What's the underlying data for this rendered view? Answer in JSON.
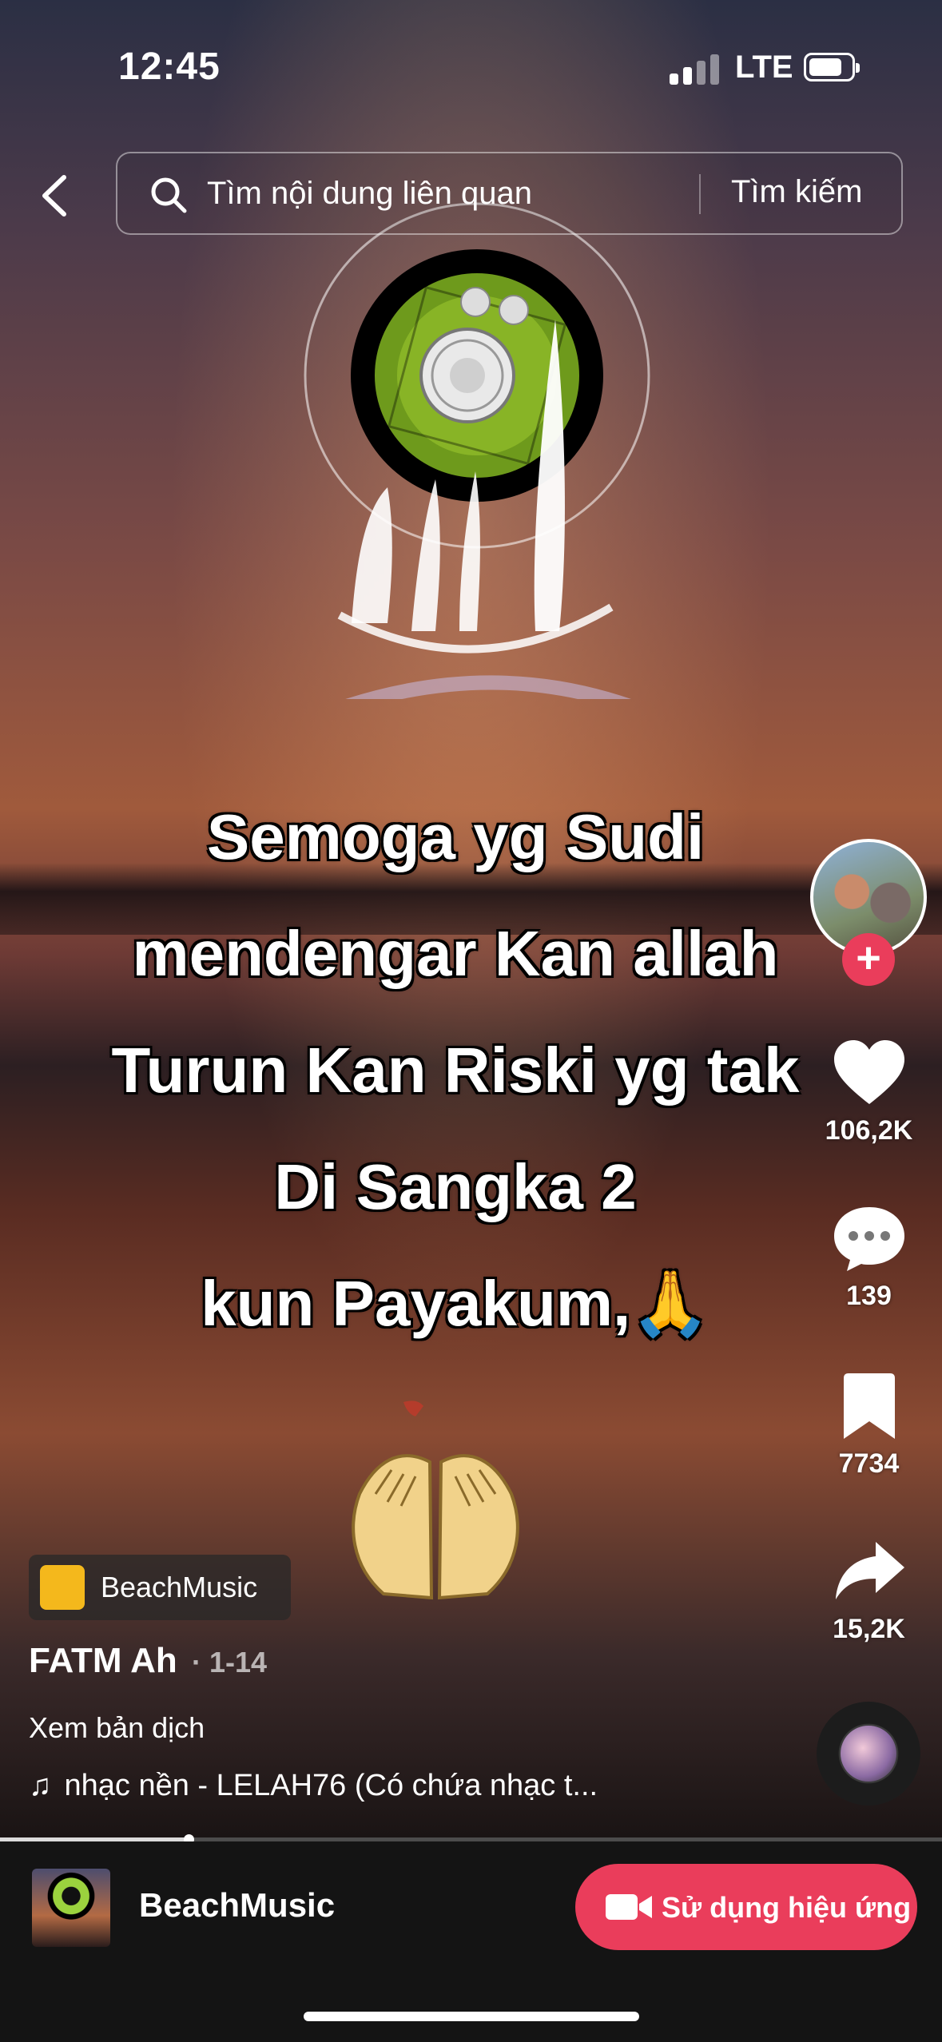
{
  "status_bar": {
    "time": "12:45",
    "network": "LTE"
  },
  "search": {
    "placeholder": "Tìm nội dung liên quan",
    "button": "Tìm kiếm"
  },
  "video": {
    "caption": "Semoga yg Sudi\nmendengar Kan allah\nTurun Kan Riski yg tak\nDi Sangka 2\nkun Payakum,🙏"
  },
  "actions": {
    "likes": "106,2K",
    "comments": "139",
    "bookmarks": "7734",
    "shares": "15,2K"
  },
  "effect": {
    "name": "BeachMusic"
  },
  "post": {
    "author": "FATM Ah",
    "date": "· 1-14",
    "translate": "Xem bản dịch",
    "music": "nhạc nền - LELAH76 (Có chứa nhạc t..."
  },
  "progress": {
    "played_fraction": 0.2
  },
  "bottom_bar": {
    "effect_name": "BeachMusic",
    "use_button": "Sử dụng hiệu ứng"
  },
  "colors": {
    "accent": "#ea3d5b"
  }
}
